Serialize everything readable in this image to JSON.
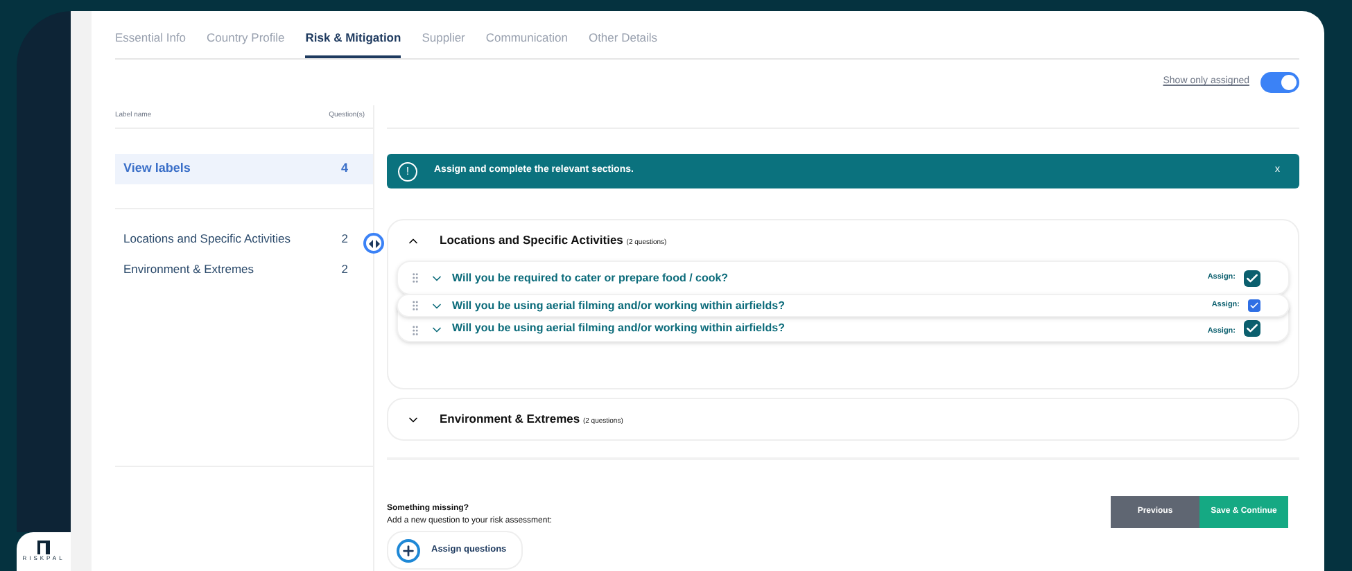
{
  "tabs": [
    {
      "label": "Essential Info",
      "selected": false
    },
    {
      "label": "Country Profile",
      "selected": false
    },
    {
      "label": "Risk & Mitigation",
      "selected": true
    },
    {
      "label": "Supplier",
      "selected": false
    },
    {
      "label": "Communication",
      "selected": false
    },
    {
      "label": "Other Details",
      "selected": false
    }
  ],
  "filter": {
    "label": "Show only assigned",
    "on": true
  },
  "labels_table": {
    "columns": [
      "Label name",
      "Question(s)"
    ],
    "summary": {
      "label": "View labels",
      "count": "4",
      "selected": true
    },
    "items": [
      {
        "label": "Locations and Specific Activities",
        "count": "2",
        "selected": false
      },
      {
        "label": "Environment & Extremes",
        "count": "2",
        "selected": false
      }
    ]
  },
  "banner": {
    "icon": "!",
    "text": "Assign and complete the relevant sections.",
    "close": "x"
  },
  "sections": [
    {
      "title": "Locations and Specific Activities",
      "count_note": "(2 questions)",
      "expanded": true,
      "questions": [
        {
          "text": "Will you be required to cater or prepare food / cook?",
          "assign_label": "Assign:",
          "checked": true
        },
        {
          "text": "Will you be using aerial filming and/or working within airfields?",
          "assign_label": "Assign:",
          "checked": true
        }
      ],
      "drag_preview": {
        "text": "Will you be using aerial filming and/or working within airfields?",
        "assign_label": "Assign:",
        "checked": true
      }
    },
    {
      "title": "Environment & Extremes",
      "count_note": "(2 questions)",
      "expanded": false
    }
  ],
  "missing": {
    "title": "Something missing?",
    "text": "Add a new question to your risk assessment:",
    "button": "Assign questions"
  },
  "buttons": {
    "previous": "Previous",
    "save": "Save & Continue"
  },
  "logo": {
    "text": "RISKPAL"
  }
}
